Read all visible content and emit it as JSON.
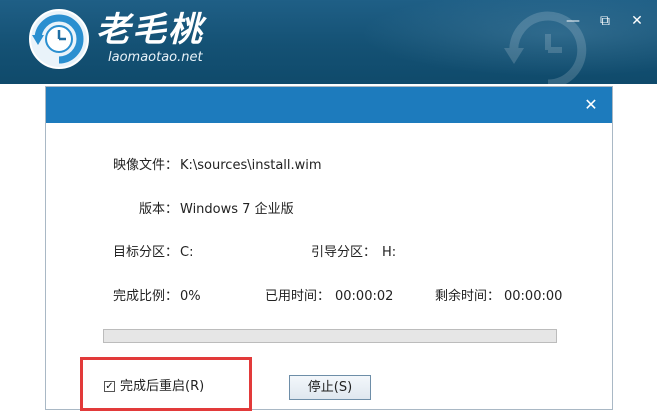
{
  "header": {
    "logo_text": "老毛桃",
    "logo_url": "laomaotao.net",
    "icons": [
      "logo-clock-icon",
      "minimize-icon",
      "maximize-icon",
      "close-icon"
    ],
    "colors": {
      "header_bg": "#145174",
      "dialog_title": "#1d7bbd",
      "highlight_border": "#e23a3a"
    }
  },
  "dialog": {
    "image_file_label": "映像文件：",
    "image_file_value": "K:\\sources\\install.wim",
    "version_label": "版本：",
    "version_value": "Windows 7 企业版",
    "target_partition_label": "目标分区：",
    "target_partition_value": "C:",
    "boot_partition_label": "引导分区：",
    "boot_partition_value": "H:",
    "completion_label": "完成比例：",
    "completion_value": "0%",
    "elapsed_label": "已用时间：",
    "elapsed_value": "00:00:02",
    "remaining_label": "剩余时间：",
    "remaining_value": "00:00:00",
    "progress_fraction": 0.0,
    "reboot_checkbox_label": "完成后重启(R)",
    "reboot_checked": true,
    "stop_button_label": "停止(S)"
  }
}
